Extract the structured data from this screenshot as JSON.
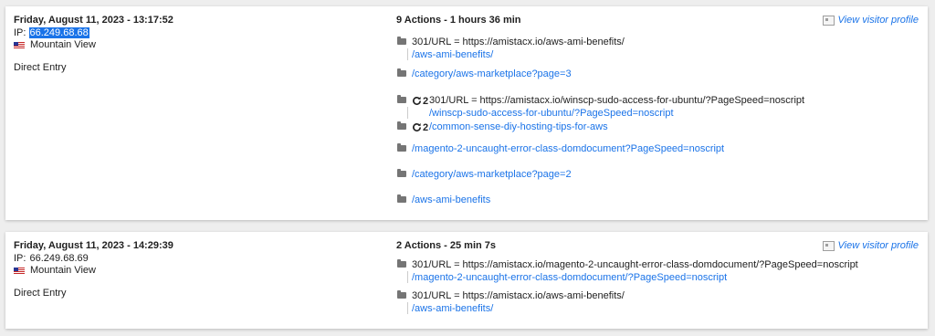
{
  "visits": [
    {
      "date": "Friday, August 11, 2023 - 13:17:52",
      "ip_label": "IP: ",
      "ip": "66.249.68.68",
      "location": "Mountain View",
      "referrer": "Direct Entry",
      "summary": "9 Actions - 1 hours 36 min",
      "profile_label": "View visitor profile",
      "actions": [
        {
          "title": "301/URL = https://amistacx.io/aws-ami-benefits/",
          "url": "/aws-ami-benefits/"
        },
        {
          "url": "/category/aws-marketplace?page=3"
        },
        {
          "reload": "2",
          "title": "301/URL = https://amistacx.io/winscp-sudo-access-for-ubuntu/?PageSpeed=noscript",
          "url": "/winscp-sudo-access-for-ubuntu/?PageSpeed=noscript"
        },
        {
          "reload": "2",
          "url": "/common-sense-diy-hosting-tips-for-aws"
        },
        {
          "url": "/magento-2-uncaught-error-class-domdocument?PageSpeed=noscript"
        },
        {
          "url": "/category/aws-marketplace?page=2"
        },
        {
          "url": "/aws-ami-benefits"
        }
      ]
    },
    {
      "date": "Friday, August 11, 2023 - 14:29:39",
      "ip_label": "IP: ",
      "ip": "66.249.68.69",
      "location": "Mountain View",
      "referrer": "Direct Entry",
      "summary": "2 Actions - 25 min 7s",
      "profile_label": "View visitor profile",
      "actions": [
        {
          "title": "301/URL = https://amistacx.io/magento-2-uncaught-error-class-domdocument/?PageSpeed=noscript",
          "url": "/magento-2-uncaught-error-class-domdocument/?PageSpeed=noscript"
        },
        {
          "title": "301/URL = https://amistacx.io/aws-ami-benefits/",
          "url": "/aws-ami-benefits/"
        }
      ]
    }
  ]
}
